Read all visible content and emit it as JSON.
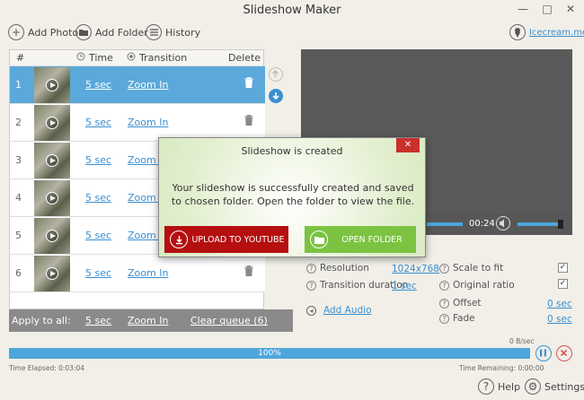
{
  "window": {
    "title": "Slideshow Maker",
    "minimize": "—",
    "maximize": "□",
    "close": "✕"
  },
  "toolbar": {
    "add_photo": "Add Photo",
    "add_folder": "Add Folder",
    "history": "History",
    "brand": "Icecream.me"
  },
  "list": {
    "headers": {
      "num": "#",
      "time": "Time",
      "transition": "Transition",
      "delete": "Delete"
    },
    "rows": [
      {
        "num": "1",
        "time": "5 sec",
        "transition": "Zoom In"
      },
      {
        "num": "2",
        "time": "5 sec",
        "transition": "Zoom In"
      },
      {
        "num": "3",
        "time": "5 sec",
        "transition": "Zoom In"
      },
      {
        "num": "4",
        "time": "5 sec",
        "transition": "Zoom In"
      },
      {
        "num": "5",
        "time": "5 sec",
        "transition": "Zoom In"
      },
      {
        "num": "6",
        "time": "5 sec",
        "transition": "Zoom In"
      }
    ],
    "apply_all": {
      "label": "Apply to all:",
      "time": "5 sec",
      "transition": "Zoom In",
      "clear": "Clear queue (6)"
    }
  },
  "player": {
    "time": "00:24"
  },
  "settings": {
    "resolution_label": "Resolution",
    "resolution_value": "1024x768",
    "transition_duration_label": "Transition duration",
    "transition_duration_value": "1 sec",
    "add_audio": "Add Audio",
    "scale_label": "Scale to fit",
    "scale_checked": true,
    "original_label": "Original ratio",
    "original_checked": true,
    "offset_label": "Offset",
    "offset_value": "0 sec",
    "fade_label": "Fade",
    "fade_value": "0 sec"
  },
  "progress": {
    "speed": "0 B/sec",
    "percent": "100%",
    "elapsed": "Time Elapsed: 0:03:04",
    "remaining": "Time Remaining: 0:00:00"
  },
  "bottom": {
    "help": "Help",
    "settings": "Settings"
  },
  "modal": {
    "title": "Slideshow is created",
    "message": "Your slideshow is successfully created and saved to chosen folder. Open the folder to view the file.",
    "upload": "UPLOAD TO YOUTUBE",
    "open": "OPEN FOLDER",
    "close": "✕"
  },
  "colors": {
    "accent": "#5aa9da",
    "upload": "#b50f10",
    "open": "#7cc342",
    "close": "#c9302c"
  }
}
